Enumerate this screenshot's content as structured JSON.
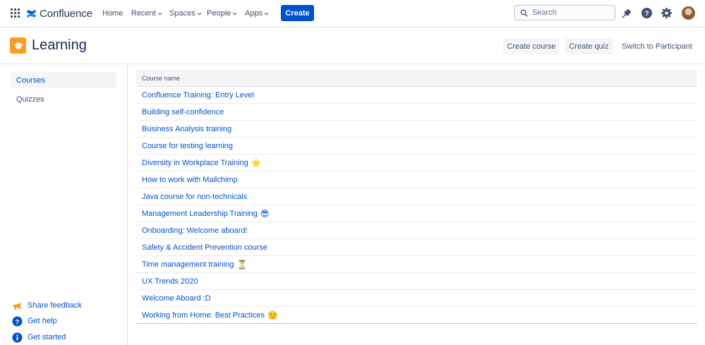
{
  "nav": {
    "brand": "Confluence",
    "items": [
      {
        "label": "Home",
        "has_dropdown": false
      },
      {
        "label": "Recent",
        "has_dropdown": true
      },
      {
        "label": "Spaces",
        "has_dropdown": true
      },
      {
        "label": "People",
        "has_dropdown": true
      },
      {
        "label": "Apps",
        "has_dropdown": true
      }
    ],
    "create_label": "Create",
    "search_placeholder": "Search",
    "icons": [
      "apps-grid-icon",
      "confluence-logo-icon",
      "search-icon",
      "notifications-icon",
      "help-icon",
      "settings-icon",
      "avatar"
    ]
  },
  "header": {
    "title": "Learning",
    "create_course_label": "Create course",
    "create_quiz_label": "Create quiz",
    "switch_label": "Switch to Participant"
  },
  "sidebar": {
    "items": [
      {
        "label": "Courses",
        "active": true
      },
      {
        "label": "Quizzes",
        "active": false
      }
    ],
    "footer": [
      {
        "label": "Share feedback",
        "icon": "megaphone-icon"
      },
      {
        "label": "Get help",
        "icon": "help-circle-icon"
      },
      {
        "label": "Get started",
        "icon": "info-circle-icon"
      }
    ]
  },
  "table": {
    "column_header": "Course name",
    "rows": [
      {
        "name": "Confluence Training: Entry Level",
        "emoji": ""
      },
      {
        "name": "Building self-confidence",
        "emoji": ""
      },
      {
        "name": "Business Analysis training",
        "emoji": ""
      },
      {
        "name": "Course for testing learning",
        "emoji": ""
      },
      {
        "name": "Diversity in Workplace Training",
        "emoji": "⭐"
      },
      {
        "name": "How to work with Mailchimp",
        "emoji": ""
      },
      {
        "name": "Java course for non-technicals",
        "emoji": ""
      },
      {
        "name": "Management Leadership Training",
        "emoji": "😎"
      },
      {
        "name": "Onboarding: Welcome aboard!",
        "emoji": ""
      },
      {
        "name": "Safety & Accident Prevention course",
        "emoji": ""
      },
      {
        "name": "Time management training",
        "emoji": "⏳"
      },
      {
        "name": "UX Trends 2020",
        "emoji": ""
      },
      {
        "name": "Welcome Aboard :D",
        "emoji": ""
      },
      {
        "name": "Working from Home: Best Practices",
        "emoji": "🙂"
      }
    ]
  },
  "colors": {
    "accent": "#0052cc",
    "learning_icon": "#ff991f"
  }
}
